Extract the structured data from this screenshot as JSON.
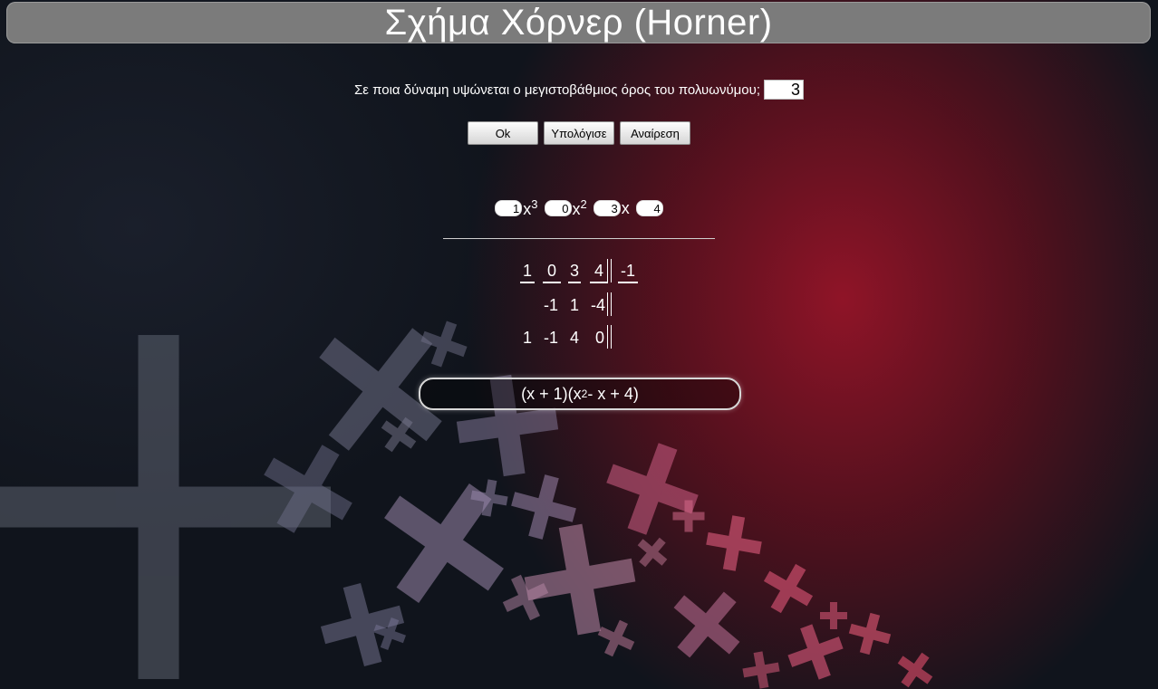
{
  "app": {
    "title": "Σχήμα Χόρνερ (Horner)"
  },
  "degree": {
    "prompt": "Σε ποια δύναμη υψώνεται ο μεγιστοβάθμιος όρος του πολυωνύμου;",
    "value": "3"
  },
  "buttons": {
    "ok": "Ok",
    "calculate": "Υπολόγισε",
    "undo": "Αναίρεση"
  },
  "polynomial": {
    "coefficients": [
      "1",
      "0",
      "3",
      "4"
    ],
    "var_x": "x",
    "exp3": "3",
    "exp2": "2"
  },
  "horner": {
    "row1": [
      "1",
      "0",
      "3",
      "4"
    ],
    "root": "-1",
    "row2": [
      "-1",
      "1",
      "-4"
    ],
    "row3": [
      "1",
      "-1",
      "4",
      "0"
    ]
  },
  "result": {
    "part1": "(x + 1)(x",
    "exp": "2",
    "part2": " - x + 4)"
  },
  "colors": {
    "title_bg": "#7b7b7b",
    "accent_red": "#a01428",
    "background_dark": "#141922"
  },
  "icons": {
    "background_decor": "plus-pattern-decor"
  }
}
